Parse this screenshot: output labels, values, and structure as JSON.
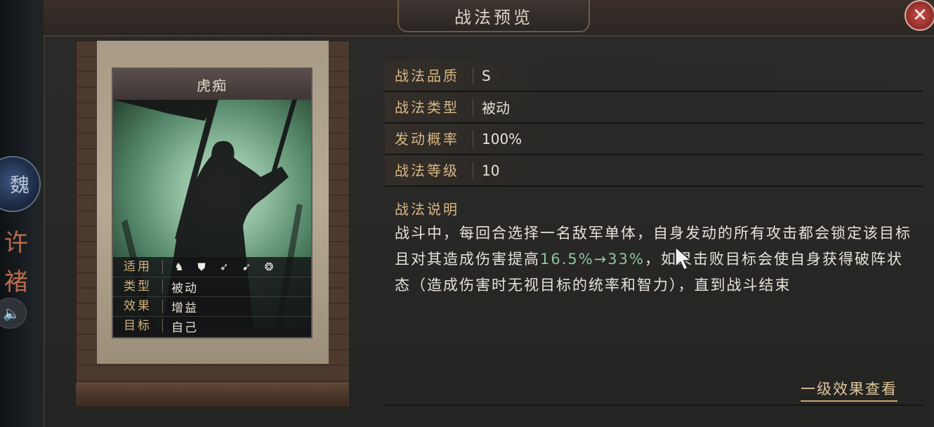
{
  "header": {
    "title": "战法预览",
    "close_icon": "close-icon"
  },
  "sidebar": {
    "faction": "魏",
    "general_name": "许褚",
    "sound_icon": "speaker-icon"
  },
  "card": {
    "name": "虎痴",
    "rows": [
      {
        "label": "适用",
        "icons": [
          "cavalry-icon",
          "shield-icon",
          "bow-icon",
          "spear-icon",
          "siege-wheel-icon"
        ]
      },
      {
        "label": "类型",
        "value": "被动"
      },
      {
        "label": "效果",
        "value": "增益"
      },
      {
        "label": "目标",
        "value": "自己"
      }
    ]
  },
  "attributes": [
    {
      "label": "战法品质",
      "value": "S"
    },
    {
      "label": "战法类型",
      "value": "被动"
    },
    {
      "label": "发动概率",
      "value": "100%"
    },
    {
      "label": "战法等级",
      "value": "10"
    }
  ],
  "description": {
    "title": "战法说明",
    "text_before": "战斗中，每回合选择一名敌军单体，自身发动的所有攻击都会锁定该目标且对其造成伤害提高",
    "highlight": "16.5%→33%",
    "text_after": "，如果击败目标会使自身获得破阵状态（造成伤害时无视目标的统率和智力），直到战斗结束"
  },
  "level_link": "一级效果查看",
  "colors": {
    "accent": "#d9b784",
    "highlight": "#8fc49c",
    "close": "#c8504a"
  }
}
